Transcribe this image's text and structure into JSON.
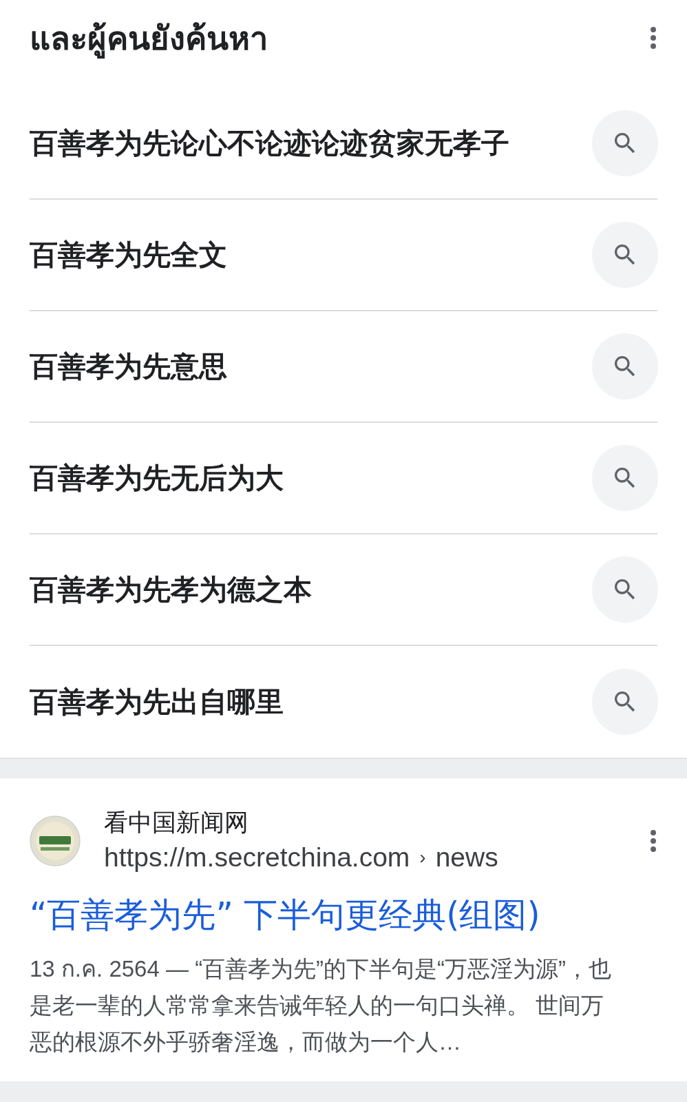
{
  "related": {
    "title": "และผู้คนยังค้นหา",
    "suggestions": [
      {
        "text": "百善孝为先论心不论迹论迹贫家无孝子"
      },
      {
        "text": "百善孝为先全文"
      },
      {
        "text": "百善孝为先意思"
      },
      {
        "text": "百善孝为先无后为大"
      },
      {
        "text": "百善孝为先孝为德之本"
      },
      {
        "text": "百善孝为先出自哪里"
      }
    ]
  },
  "result": {
    "site_name": "看中国新闻网",
    "url": "https://m.secretchina.com",
    "separator": "›",
    "breadcrumb": "news",
    "title": "“百善孝为先” 下半句更经典(组图)",
    "snippet": "13 ก.ค. 2564 — “百善孝为先”的下半句是“万恶淫为源”，也是老一辈的人常常拿来告诫年轻人的一句口头禅。 世间万恶的根源不外乎骄奢淫逸，而做为一个人…"
  }
}
